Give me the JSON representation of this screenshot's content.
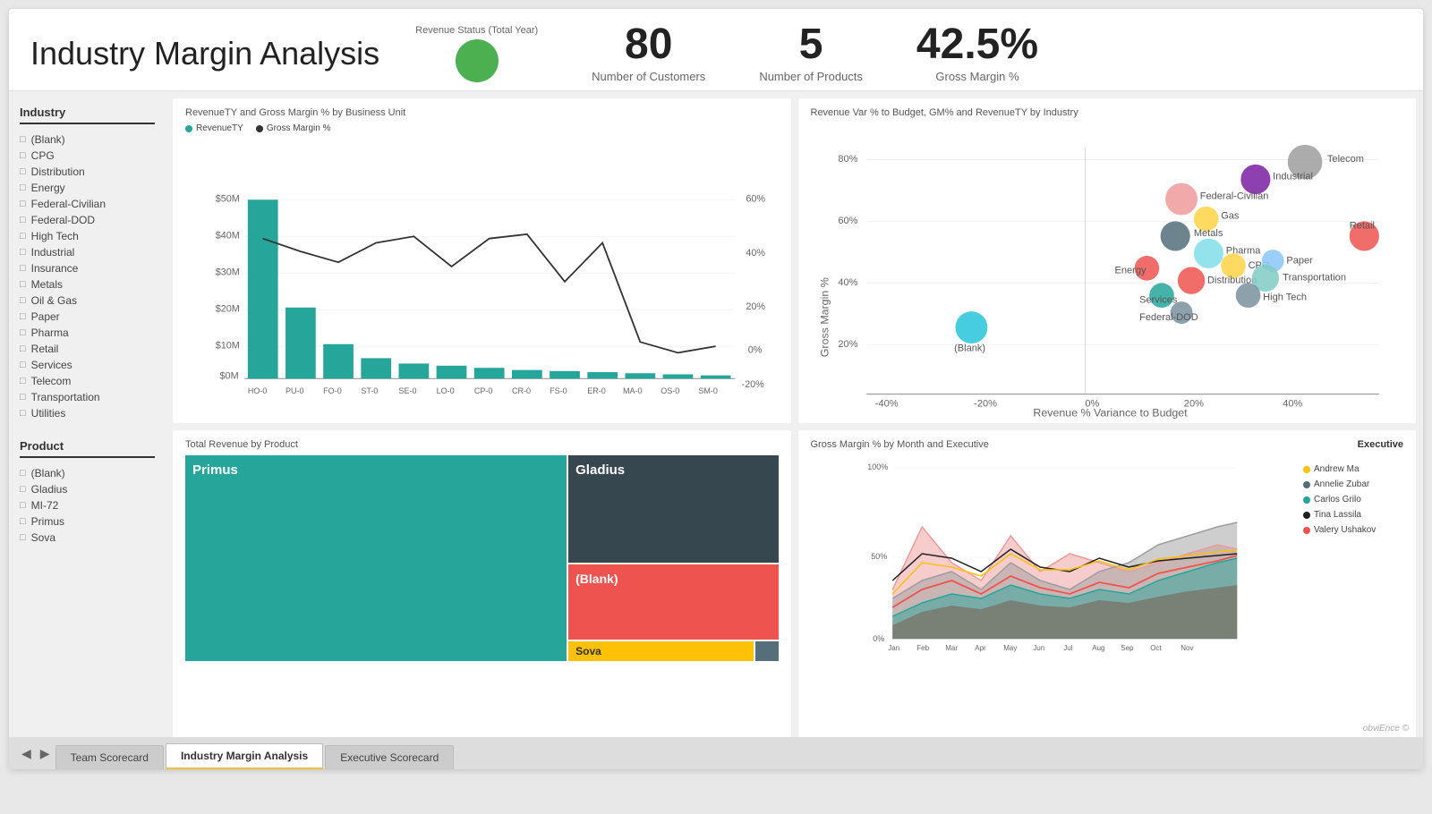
{
  "header": {
    "title": "Industry Margin Analysis",
    "revenue_status_label": "Revenue Status (Total Year)",
    "kpis": [
      {
        "value": "80",
        "label": "Number of Customers"
      },
      {
        "value": "5",
        "label": "Number of Products"
      },
      {
        "value": "42.5%",
        "label": "Gross Margin %"
      }
    ]
  },
  "sidebar": {
    "industry_label": "Industry",
    "industry_items": [
      "(Blank)",
      "CPG",
      "Distribution",
      "Energy",
      "Federal-Civilian",
      "Federal-DOD",
      "High Tech",
      "Industrial",
      "Insurance",
      "Metals",
      "Oil & Gas",
      "Paper",
      "Pharma",
      "Retail",
      "Services",
      "Telecom",
      "Transportation",
      "Utilities"
    ],
    "product_label": "Product",
    "product_items": [
      "(Blank)",
      "Gladius",
      "MI-72",
      "Primus",
      "Sova"
    ]
  },
  "charts": {
    "top_left": {
      "title": "RevenueTY and Gross Margin % by Business Unit",
      "legend_revenue": "RevenueTY",
      "legend_gm": "Gross Margin %",
      "y_labels": [
        "$50M",
        "$40M",
        "$30M",
        "$20M",
        "$10M",
        "$0M"
      ],
      "x_labels": [
        "HO-0",
        "PU-0",
        "FO-0",
        "ST-0",
        "SE-0",
        "LO-0",
        "CP-0",
        "CR-0",
        "FS-0",
        "ER-0",
        "MA-0",
        "OS-0",
        "SM-0"
      ],
      "gm_labels": [
        "60%",
        "40%",
        "20%",
        "0%",
        "-20%"
      ]
    },
    "top_right": {
      "title": "Revenue Var % to Budget, GM% and RevenueTY by Industry",
      "x_axis": "Revenue % Variance to Budget",
      "y_axis": "Gross Margin %",
      "y_labels": [
        "80%",
        "60%",
        "40%",
        "20%"
      ],
      "x_labels": [
        "-40%",
        "-20%",
        "0%",
        "20%",
        "40%"
      ],
      "bubbles": [
        {
          "label": "Telecom",
          "x": 75,
          "y": 15,
          "r": 14,
          "color": "#9e9e9e"
        },
        {
          "label": "Industrial",
          "x": 63,
          "y": 22,
          "r": 12,
          "color": "#7b1fa2"
        },
        {
          "label": "Federal-Civilian",
          "x": 54,
          "y": 30,
          "r": 13,
          "color": "#ef9a9a"
        },
        {
          "label": "Gas",
          "x": 57,
          "y": 34,
          "r": 10,
          "color": "#ffd54f"
        },
        {
          "label": "Metals",
          "x": 53,
          "y": 38,
          "r": 12,
          "color": "#546e7a"
        },
        {
          "label": "Pharma",
          "x": 57,
          "y": 42,
          "r": 12,
          "color": "#80deea"
        },
        {
          "label": "Energy",
          "x": 47,
          "y": 45,
          "r": 10,
          "color": "#ef5350"
        },
        {
          "label": "CPG",
          "x": 60,
          "y": 44,
          "r": 10,
          "color": "#ffd54f"
        },
        {
          "label": "Paper",
          "x": 67,
          "y": 42,
          "r": 9,
          "color": "#90caf9"
        },
        {
          "label": "Distribution",
          "x": 55,
          "y": 48,
          "r": 11,
          "color": "#ef5350"
        },
        {
          "label": "Transportation",
          "x": 67,
          "y": 47,
          "r": 11,
          "color": "#80cbc4"
        },
        {
          "label": "Services",
          "x": 51,
          "y": 52,
          "r": 10,
          "color": "#26a69a"
        },
        {
          "label": "High Tech",
          "x": 63,
          "y": 52,
          "r": 10,
          "color": "#78909c"
        },
        {
          "label": "Federal-DOD",
          "x": 54,
          "y": 57,
          "r": 9,
          "color": "#78909c"
        },
        {
          "label": "(Blank)",
          "x": 20,
          "y": 63,
          "r": 13,
          "color": "#26c6da"
        },
        {
          "label": "Retail",
          "x": 90,
          "y": 30,
          "r": 12,
          "color": "#ef5350"
        }
      ]
    },
    "bottom_left": {
      "title": "Total Revenue by Product",
      "cells": [
        {
          "label": "Primus",
          "color": "#26a69a",
          "flex": 3.5
        },
        {
          "label": "Gladius",
          "color": "#37474f",
          "flex": 2
        },
        {
          "label": "(Blank)",
          "color": "#ef5350",
          "flex": 1.5
        },
        {
          "label": "Sova",
          "color": "#ffc107",
          "flex": 0.5
        },
        {
          "label": "",
          "color": "#546e7a",
          "flex": 0.2
        }
      ]
    },
    "bottom_right": {
      "title": "Gross Margin % by Month and Executive",
      "y_labels": [
        "100%",
        "50%",
        "0%"
      ],
      "x_labels": [
        "Jan",
        "Feb",
        "Mar",
        "Apr",
        "May",
        "Jun",
        "Jul",
        "Aug",
        "Sep",
        "Oct",
        "Nov"
      ],
      "legend_title": "Executive",
      "executives": [
        {
          "name": "Andrew Ma",
          "color": "#ffc107"
        },
        {
          "name": "Annelie Zubar",
          "color": "#546e7a"
        },
        {
          "name": "Carlos Grilo",
          "color": "#26a69a"
        },
        {
          "name": "Tina Lassila",
          "color": "#212121"
        },
        {
          "name": "Valery Ushakov",
          "color": "#ef5350"
        }
      ]
    }
  },
  "tabs": [
    {
      "label": "Team Scorecard",
      "active": false
    },
    {
      "label": "Industry Margin Analysis",
      "active": true
    },
    {
      "label": "Executive Scorecard",
      "active": false
    }
  ],
  "credits": "obviEnce ©"
}
